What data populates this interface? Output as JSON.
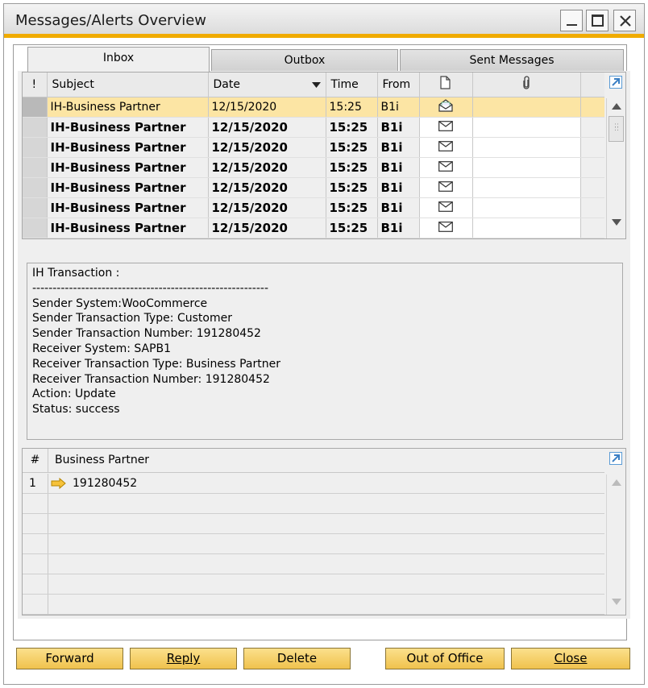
{
  "window": {
    "title": "Messages/Alerts Overview"
  },
  "tabs": [
    {
      "label": "Inbox",
      "active": true
    },
    {
      "label": "Outbox",
      "active": false
    },
    {
      "label": "Sent Messages",
      "active": false
    }
  ],
  "grid": {
    "columns": {
      "priority": "!",
      "subject": "Subject",
      "date": "Date",
      "time": "Time",
      "from": "From"
    },
    "rows": [
      {
        "subject": "IH-Business Partner",
        "date": "12/15/2020",
        "time": "15:25",
        "from": "B1i",
        "read": true,
        "selected": true
      },
      {
        "subject": "IH-Business Partner",
        "date": "12/15/2020",
        "time": "15:25",
        "from": "B1i",
        "read": false,
        "selected": false
      },
      {
        "subject": "IH-Business Partner",
        "date": "12/15/2020",
        "time": "15:25",
        "from": "B1i",
        "read": false,
        "selected": false
      },
      {
        "subject": "IH-Business Partner",
        "date": "12/15/2020",
        "time": "15:25",
        "from": "B1i",
        "read": false,
        "selected": false
      },
      {
        "subject": "IH-Business Partner",
        "date": "12/15/2020",
        "time": "15:25",
        "from": "B1i",
        "read": false,
        "selected": false
      },
      {
        "subject": "IH-Business Partner",
        "date": "12/15/2020",
        "time": "15:25",
        "from": "B1i",
        "read": false,
        "selected": false
      },
      {
        "subject": "IH-Business Partner",
        "date": "12/15/2020",
        "time": "15:25",
        "from": "B1i",
        "read": false,
        "selected": false
      }
    ]
  },
  "details": {
    "lines": [
      "IH Transaction :",
      "----------------------------------------------------------",
      "Sender System:WooCommerce",
      "Sender Transaction Type: Customer",
      "Sender Transaction Number: 191280452",
      "Receiver System: SAPB1",
      "Receiver Transaction Type: Business Partner",
      "Receiver Transaction Number: 191280452",
      "Action: Update",
      "Status: success"
    ]
  },
  "links": {
    "columns": {
      "num": "#",
      "name": "Business Partner"
    },
    "rows": [
      {
        "num": "1",
        "value": "191280452"
      }
    ]
  },
  "buttons": {
    "forward": "Forward",
    "reply": "Reply",
    "delete": "Delete",
    "out_of_office": "Out of Office",
    "close": "Close"
  },
  "colors": {
    "accent": "#f0ab00",
    "selected_row": "#fce5a4",
    "button": "#f5cf63"
  }
}
